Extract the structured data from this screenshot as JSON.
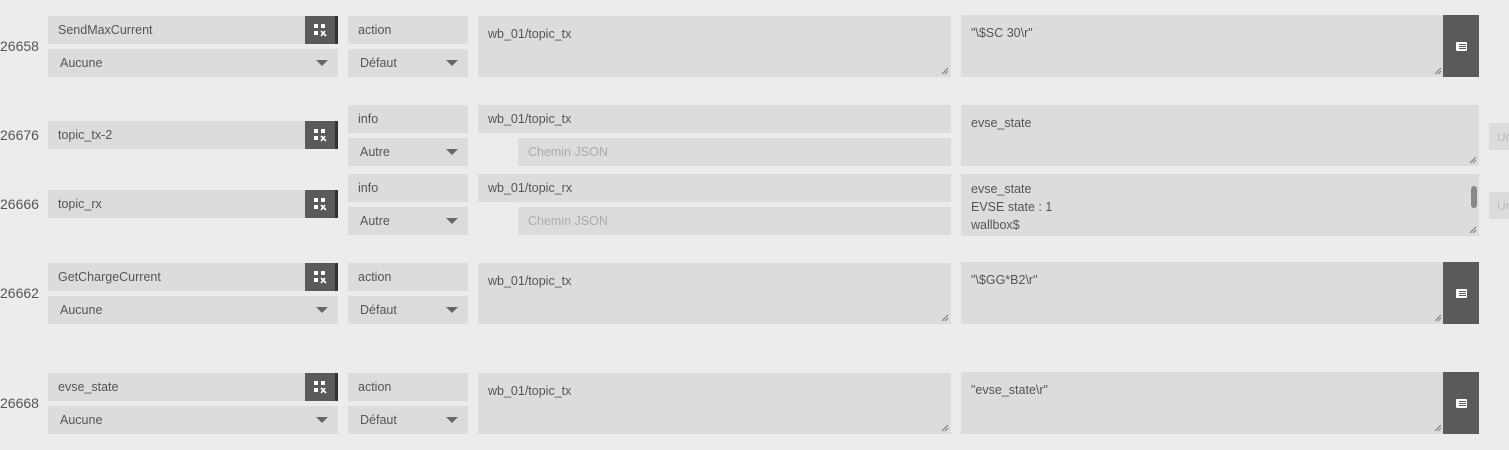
{
  "rows": [
    {
      "id": "26658",
      "name": "SendMaxCurrent",
      "type": "action",
      "subtype": "Aucune",
      "subtype2": "Défaut",
      "topic": "wb_01/topic_tx",
      "value": "\"\\$SC 30\\r\""
    },
    {
      "id": "26676",
      "name": "topic_tx-2",
      "type": "info",
      "subtype": "Autre",
      "topic": "wb_01/topic_tx",
      "json_placeholder": "Chemin JSON",
      "value": "evse_state",
      "side_cut": "Ur"
    },
    {
      "id": "26666",
      "name": "topic_rx",
      "type": "info",
      "subtype": "Autre",
      "topic": "wb_01/topic_rx",
      "json_placeholder": "Chemin JSON",
      "value_lines": [
        "evse_state",
        "EVSE state : 1",
        "wallbox$"
      ],
      "side_cut": "Ur"
    },
    {
      "id": "26662",
      "name": "GetChargeCurrent",
      "type": "action",
      "subtype": "Aucune",
      "subtype2": "Défaut",
      "topic": "wb_01/topic_tx",
      "value": "\"\\$GG*B2\\r\""
    },
    {
      "id": "26668",
      "name": "evse_state",
      "type": "action",
      "subtype": "Aucune",
      "subtype2": "Défaut",
      "topic": "wb_01/topic_tx",
      "value": "\"evse_state\\r\""
    }
  ],
  "icons": {
    "config": "wrench-cogs-icon",
    "list": "list-icon"
  }
}
